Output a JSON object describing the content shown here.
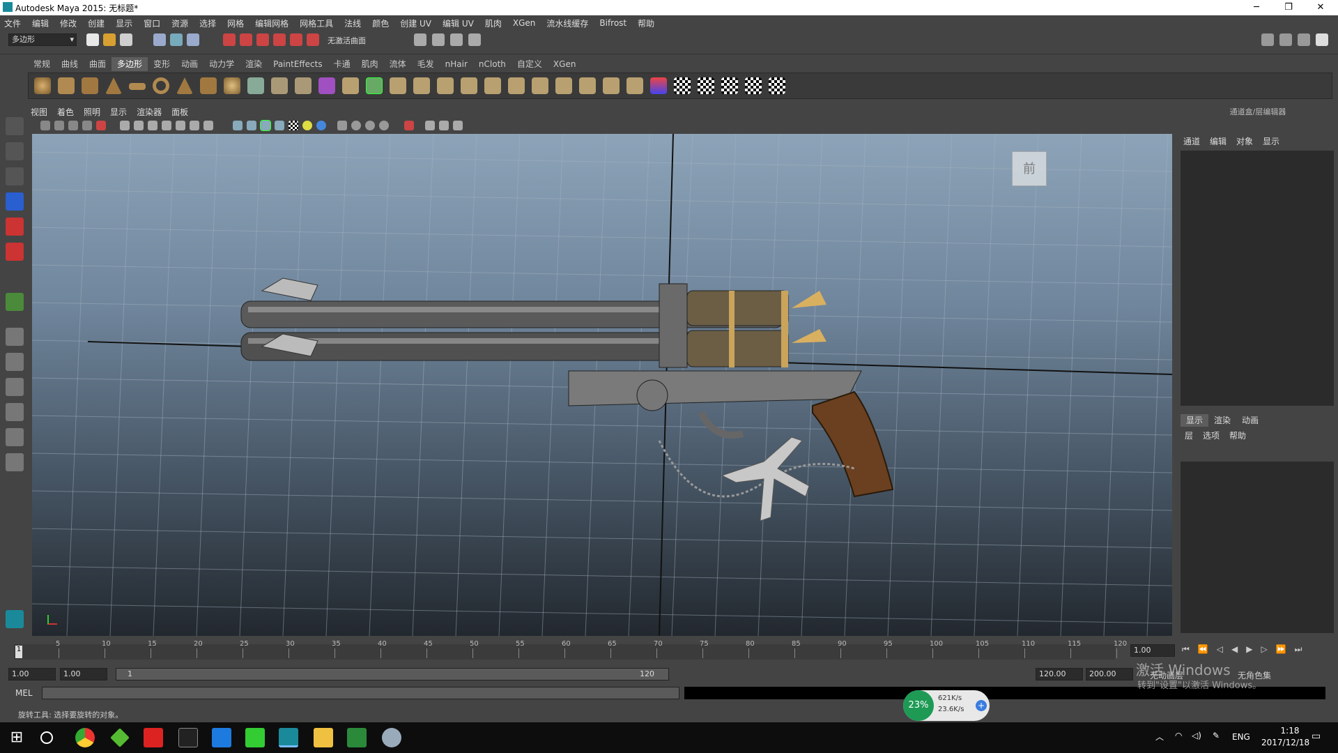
{
  "window": {
    "title": "Autodesk Maya 2015: 无标题*"
  },
  "menubar": [
    "文件",
    "编辑",
    "修改",
    "创建",
    "显示",
    "窗口",
    "资源",
    "选择",
    "网格",
    "编辑网格",
    "网格工具",
    "法线",
    "颜色",
    "创建 UV",
    "编辑 UV",
    "肌肉",
    "XGen",
    "流水线缓存",
    "Bifrost",
    "帮助"
  ],
  "status": {
    "mode": "多边形",
    "live_surface": "无激活曲面"
  },
  "shelf_tabs": [
    "常规",
    "曲线",
    "曲面",
    "多边形",
    "变形",
    "动画",
    "动力学",
    "渲染",
    "PaintEffects",
    "卡通",
    "肌肉",
    "流体",
    "毛发",
    "nHair",
    "nCloth",
    "自定义",
    "XGen"
  ],
  "shelf_active": "多边形",
  "panel_menu": [
    "视图",
    "着色",
    "照明",
    "显示",
    "渲染器",
    "面板"
  ],
  "viewcube_label": "前",
  "right_panel": {
    "title": "通道盒/层编辑器",
    "tabs1": [
      "通道",
      "编辑",
      "对象",
      "显示"
    ],
    "tabs2": [
      "显示",
      "渲染",
      "动画"
    ],
    "tabs3": [
      "层",
      "选项",
      "帮助"
    ]
  },
  "timeline": {
    "ticks": [
      "5",
      "10",
      "15",
      "20",
      "25",
      "30",
      "35",
      "40",
      "45",
      "50",
      "55",
      "60",
      "65",
      "70",
      "75",
      "80",
      "85",
      "90",
      "95",
      "100",
      "105",
      "110",
      "115",
      "120"
    ],
    "current_frame_left": "1",
    "current_time": "1.00"
  },
  "range": {
    "start": "1.00",
    "start2": "1.00",
    "inner_start": "1",
    "inner_end": "120",
    "end": "120.00",
    "end2": "200.00",
    "anim_layer": "无动画层",
    "char_set": "无角色集"
  },
  "cmd": {
    "label": "MEL"
  },
  "help": {
    "text": "旋转工具: 选择要旋转的对象。"
  },
  "watermark": {
    "line1": "激活 Windows",
    "line2": "转到\"设置\"以激活 Windows。"
  },
  "net": {
    "percent": "23%",
    "up": "621K/s",
    "down": "23.6K/s"
  },
  "taskbar": {
    "lang": "ENG",
    "time": "1:18",
    "date": "2017/12/18"
  }
}
